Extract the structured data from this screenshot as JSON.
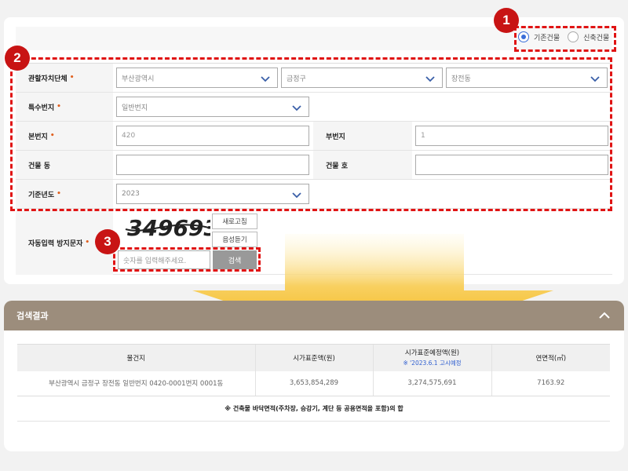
{
  "building_type": {
    "options": [
      {
        "label": "기존건물",
        "selected": true
      },
      {
        "label": "신축건물",
        "selected": false
      }
    ]
  },
  "form": {
    "region_label": "관할자치단체",
    "region_sido": "부산광역시",
    "region_sigungu": "금정구",
    "region_dong": "장전동",
    "special_label": "특수번지",
    "special_value": "일반번지",
    "main_lot_label": "본번지",
    "main_lot_value": "420",
    "sub_lot_label": "부번지",
    "sub_lot_value": "1",
    "bldg_dong_label": "건물 동",
    "bldg_dong_value": "",
    "bldg_ho_label": "건물 호",
    "bldg_ho_value": "",
    "year_label": "기준년도",
    "year_value": "2023",
    "required_mark": "•"
  },
  "captcha": {
    "label": "자동입력 방지문자",
    "code": "349693",
    "refresh_label": "새로고침",
    "audio_label": "음성듣기",
    "input_placeholder": "숫자를 입력해주세요.",
    "search_label": "검색"
  },
  "badges": [
    "1",
    "2",
    "3"
  ],
  "results": {
    "title": "검색결과",
    "columns": {
      "address": "물건지",
      "price": "시가표준액(원)",
      "expected": "시가표준예정액(원)",
      "expected_note": "※ '2023.6.1 고시예정",
      "area": "연면적(㎡)"
    },
    "rows": [
      {
        "address": "부산광역시 금정구 장전동 일반번지 0420-0001번지 0001동",
        "price": "3,653,854,289",
        "expected": "3,274,575,691",
        "area": "7163.92"
      }
    ],
    "footnote": "※ 건축물 바닥면적(주차장, 승강기, 계단 등 공용면적을 포함)의 합"
  },
  "colors": {
    "accent_red": "#e01414",
    "badge_red": "#c81414",
    "header_brown": "#9c8d7c",
    "arrow_gold": "#f5b800",
    "radio_blue": "#3a6ed8"
  }
}
